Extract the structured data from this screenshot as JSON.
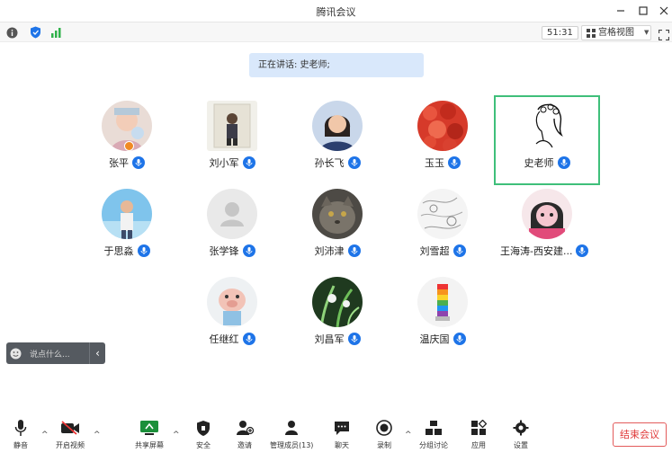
{
  "window": {
    "title": "腾讯会议"
  },
  "statusbar": {
    "timer": "51:31",
    "view_label": "宫格视图",
    "icons": [
      "info-icon",
      "shield-icon",
      "signal-icon",
      "fullscreen-icon"
    ]
  },
  "speaker": {
    "text": "正在讲话: 史老师;"
  },
  "participants": [
    {
      "name": "张平",
      "mic": true,
      "host": true,
      "avatar": "photo-child"
    },
    {
      "name": "刘小军",
      "mic": true,
      "avatar": "photo-person"
    },
    {
      "name": "孙长飞",
      "mic": true,
      "avatar": "photo-woman"
    },
    {
      "name": "玉玉",
      "mic": true,
      "avatar": "photo-red-flowers"
    },
    {
      "name": "史老师",
      "mic": true,
      "active": true,
      "avatar": "sketch-woman"
    },
    {
      "name": "于思淼",
      "mic": true,
      "avatar": "photo-man-sky"
    },
    {
      "name": "张学锋",
      "mic": true,
      "avatar": "default-avatar"
    },
    {
      "name": "刘沛津",
      "mic": true,
      "avatar": "photo-cat"
    },
    {
      "name": "刘雪超",
      "mic": true,
      "avatar": "sketch-pattern"
    },
    {
      "name": "王海涛-西安建...",
      "mic": true,
      "avatar": "cartoon-girl"
    },
    {
      "name": "任继红",
      "mic": true,
      "avatar": "cartoon-pig"
    },
    {
      "name": "刘昌军",
      "mic": true,
      "avatar": "photo-plants"
    },
    {
      "name": "温庆国",
      "mic": true,
      "avatar": "photo-rainbow"
    }
  ],
  "chat": {
    "placeholder": "说点什么..."
  },
  "toolbar": {
    "mute": "静音",
    "video": "开启视频",
    "share": "共享屏幕",
    "security": "安全",
    "invite": "邀请",
    "members": "管理成员(13)",
    "chat": "聊天",
    "record": "录制",
    "breakout": "分组讨论",
    "apps": "应用",
    "settings": "设置",
    "end": "结束会议"
  },
  "colors": {
    "accent": "#1e74e8",
    "active_border": "#3fbf7a",
    "end_red": "#e03a3a",
    "speaker_bg": "#d9e8fb"
  }
}
